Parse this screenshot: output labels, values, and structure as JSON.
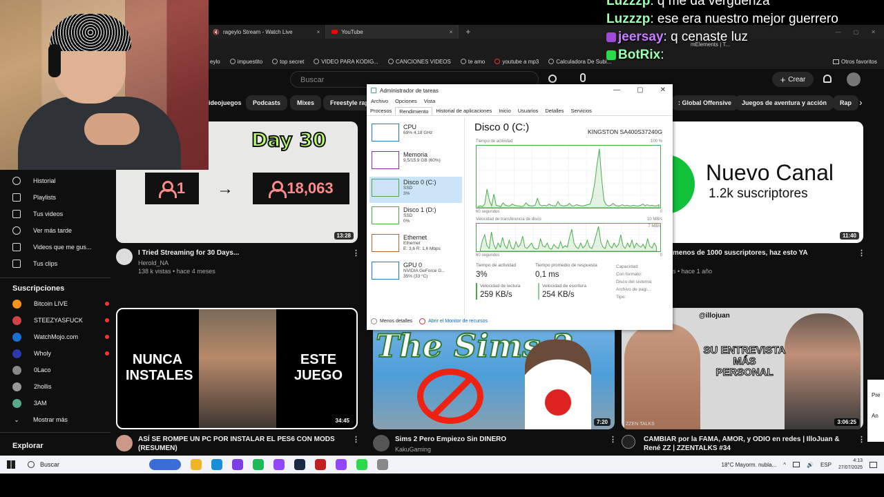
{
  "chat": {
    "lines": [
      {
        "user": "Luzzzp",
        "sep": ":",
        "text": " q me da vergüenza",
        "color": "#9dffb0"
      },
      {
        "user": "Luzzzp",
        "sep": ":",
        "text": " ese era nuestro mejor guerrero",
        "color": "#9dffb0"
      },
      {
        "user": "jeersay",
        "sep": ":",
        "text": " q cenaste luz",
        "color": "#c77dff"
      },
      {
        "user": "BotRix",
        "sep": ":",
        "text": "",
        "color": "#9dffb0"
      }
    ]
  },
  "browser": {
    "tabs": [
      {
        "label": "rageylo Stream - Watch Live",
        "close": "×"
      },
      {
        "label": "YouTube",
        "close": "×"
      }
    ],
    "new_tab": "+",
    "window_controls": [
      "—",
      "▢",
      "✕"
    ],
    "overflow_text": "mElements | T...",
    "bookmarks": [
      "eylo",
      "impuestito",
      "top secret",
      "VIDEO PARA KODIG...",
      "CANCIONES VIDEOS",
      "te amo",
      "youtube a mp3",
      "Calculadora De Subi..."
    ],
    "bookmarks_other": "Otros favoritos"
  },
  "youtube": {
    "search_placeholder": "Buscar",
    "create_label": "Crear",
    "chips": [
      "ideojuegos",
      "Podcasts",
      "Mixes",
      "Freestyle rap",
      ": Global Offensive",
      "Juegos de aventura y acción",
      "Rap"
    ],
    "chip_next": "›",
    "sidebar": {
      "items": [
        "Historial",
        "Playlists",
        "Tus videos",
        "Ver más tarde",
        "Videos que me gus...",
        "Tus clips"
      ],
      "subs_title": "Suscripciones",
      "subscriptions": [
        {
          "name": "Bitcoin LIVE",
          "color": "#f7931a",
          "live": true
        },
        {
          "name": "STEEZYASFUCK",
          "color": "#c44",
          "live": true
        },
        {
          "name": "WatchMojo.com",
          "color": "#1a6fd1",
          "live": true
        },
        {
          "name": "Wholy",
          "color": "#2a3aa8",
          "live": true
        },
        {
          "name": "0Laco",
          "color": "#888",
          "live": false
        },
        {
          "name": "2hollis",
          "color": "#999",
          "live": false
        },
        {
          "name": "3AM",
          "color": "#5a8",
          "live": false
        }
      ],
      "show_more": "Mostrar más",
      "explore": "Explorar"
    },
    "videos": [
      {
        "title": "I Tried Streaming for 30 Days...",
        "channel": "Herold_NA",
        "meta": "138 k vistas • hace 4 meses",
        "duration": "13:28",
        "thumb_day": "Day 30",
        "thumb_from": "1",
        "thumb_arrow": "→",
        "thumb_to": "18,063"
      },
      {
        "title": "menos de 1000 suscriptores, haz esto YA",
        "meta": "s • hace 1 año",
        "duration": "11:40",
        "thumb_title": "Nuevo Canal",
        "thumb_sub": "1.2k suscriptores"
      },
      {
        "title": "ASÍ SE ROMPE UN PC POR INSTALAR EL PES6 CON MODS (RESUMEN)",
        "duration": "34:45",
        "thumb_left": "NUNCA INSTALES",
        "thumb_right": "ESTE JUEGO"
      },
      {
        "title": "Sims 2 Pero Empiezo Sin DINERO",
        "channel": "KakuGaming",
        "duration": "7:20",
        "thumb_logo": "The Sims 2"
      },
      {
        "title": "CAMBIAR por la FAMA, AMOR, y ODIO en redes | IlloJuan & René ZZ | ZZENTALKS #34",
        "duration": "3:06:25",
        "thumb_handle": "@illojuan",
        "thumb_text": "SU ENTREVISTA MÁS PERSONAL",
        "thumb_tag": "ZZEN TALKS"
      }
    ],
    "kebab": "⋮"
  },
  "taskmgr": {
    "title": "Administrador de tareas",
    "menu": [
      "Archivo",
      "Opciones",
      "Vista"
    ],
    "tabs": [
      "Procesos",
      "Rendimiento",
      "Historial de aplicaciones",
      "Inicio",
      "Usuarios",
      "Detalles",
      "Servicios"
    ],
    "resources": [
      {
        "name": "CPU",
        "sub1": "69% 4,18 GHz",
        "sub2": "",
        "color": "#1a78c2"
      },
      {
        "name": "Memoria",
        "sub1": "9,5/15,9 GB (60%)",
        "sub2": "",
        "color": "#8b2aa8"
      },
      {
        "name": "Disco 0 (C:)",
        "sub1": "SSD",
        "sub2": "3%",
        "color": "#4aa84a"
      },
      {
        "name": "Disco 1 (D:)",
        "sub1": "SSD",
        "sub2": "0%",
        "color": "#4aa84a"
      },
      {
        "name": "Ethernet",
        "sub1": "Ethernet",
        "sub2": "E: 3,6  R: 1,6 Mbps",
        "color": "#c0602a"
      },
      {
        "name": "GPU 0",
        "sub1": "NVIDIA GeForce G...",
        "sub2": "35% (33 °C)",
        "color": "#1a78c2"
      }
    ],
    "heading": "Disco 0 (C:)",
    "model": "KINGSTON SA400S37240G",
    "graph1_label": "Tiempo de actividad",
    "graph1_max": "100 %",
    "graph1_axis": "60 segundos",
    "graph1_min": "0",
    "graph1_points": [
      2,
      3,
      2,
      6,
      30,
      12,
      3,
      22,
      4,
      3,
      2,
      8,
      4,
      3,
      3,
      6,
      4,
      3,
      3,
      2,
      3,
      8,
      4,
      3,
      3,
      4,
      15,
      5,
      3,
      4,
      3,
      6,
      4,
      3,
      3,
      10,
      4,
      3,
      3,
      4,
      7,
      3,
      3,
      5,
      4,
      3,
      3,
      4,
      5,
      6,
      18,
      40,
      70,
      95,
      48,
      12,
      5,
      3,
      4,
      7,
      4,
      3,
      3,
      5,
      3,
      4,
      3,
      3,
      4,
      3,
      3,
      4,
      6,
      3,
      5,
      3,
      4,
      3,
      3,
      5
    ],
    "graph2_label": "Velocidad de transferencia de disco",
    "graph2_max": "10 MB/s",
    "graph2_ref": "7 MB/s",
    "graph2_axis": "60 segundos",
    "graph2_min": "0",
    "graph2_points": [
      5,
      40,
      60,
      20,
      10,
      70,
      25,
      8,
      30,
      15,
      50,
      20,
      10,
      40,
      12,
      8,
      35,
      15,
      25,
      55,
      15,
      10,
      20,
      30,
      12,
      8,
      10,
      45,
      20,
      15,
      30,
      10,
      8,
      25,
      15,
      10,
      35,
      12,
      20,
      15,
      50,
      80,
      30,
      15,
      10,
      30,
      12,
      20,
      40,
      15,
      10,
      30,
      60,
      90,
      35,
      15,
      10,
      40,
      20,
      12,
      30,
      15,
      25,
      60,
      20,
      10,
      30,
      15,
      40,
      12,
      30,
      20,
      15,
      25,
      10,
      45,
      18,
      12,
      30,
      15
    ],
    "stats": {
      "active_label": "Tiempo de actividad",
      "active_val": "3%",
      "resp_label": "Tiempo promedio de respuesta",
      "resp_val": "0,1 ms",
      "read_label": "Velocidad de lectura",
      "read_val": "259 KB/s",
      "write_label": "Velocidad de escritura",
      "write_val": "254 KB/s",
      "cap_lines": [
        "Capacidad:",
        "Con formato:",
        "Disco del sistema:",
        "Archivo de pagi...",
        "Tipo:"
      ]
    },
    "footer_less": "Menos detalles",
    "footer_monitor": "Abrir el Monitor de recursos"
  },
  "taskbar": {
    "search": "Buscar",
    "weather": "18°C  Mayorm. nubla...",
    "chevron": "^",
    "lang": "ESP",
    "time": "4:13",
    "date": "27/07/2025",
    "icon_colors": [
      "#3a6dd8",
      "#f0b429",
      "#1a8fd8",
      "#7b3fe4",
      "#1db954",
      "#9146ff",
      "#1a2a44",
      "#c21e1e",
      "#9146ff",
      "#2bd94a",
      "#888"
    ]
  },
  "edge_popup": [
    "Pre",
    "An"
  ]
}
